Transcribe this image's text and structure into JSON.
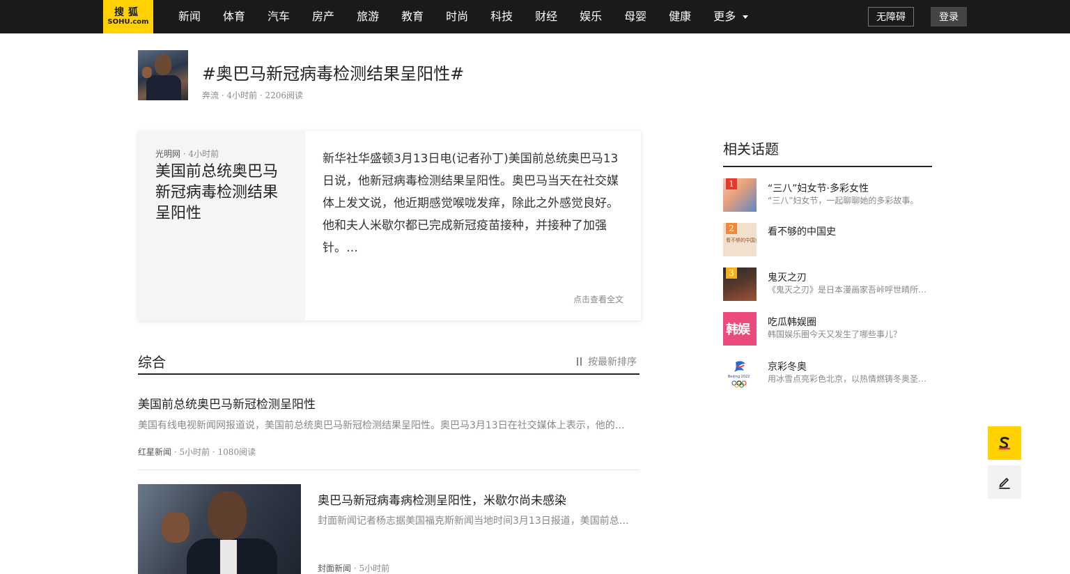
{
  "header": {
    "logo_cn": "搜狐",
    "logo_en": "SOHU.com",
    "nav": [
      "新闻",
      "体育",
      "汽车",
      "房产",
      "旅游",
      "教育",
      "时尚",
      "科技",
      "财经",
      "娱乐",
      "母婴",
      "健康"
    ],
    "more_label": "更多",
    "accessibility_label": "无障碍",
    "login_label": "登录"
  },
  "topic": {
    "title": "#奥巴马新冠病毒检测结果呈阳性#",
    "meta": "奔流 · 4小时前 · 2206阅读"
  },
  "featured": {
    "source": "光明网",
    "time": " · 4小时前",
    "title": "美国前总统奥巴马新冠病毒检测结果呈阳性",
    "summary": "新华社华盛顿3月13日电(记者孙丁)美国前总统奥巴马13日说，他新冠病毒检测结果呈阳性。奥巴马当天在社交媒体上发文说，他近期感觉喉咙发痒，除此之外感觉良好。他和夫人米歇尔都已完成新冠疫苗接种，并接种了加强针。…",
    "read_all": "点击查看全文"
  },
  "section": {
    "title": "综合",
    "sort_label": "按最新排序"
  },
  "articles": [
    {
      "title": "美国前总统奥巴马新冠检测呈阳性",
      "summary": "美国有线电视新闻网报道说，美国前总统奥巴马新冠检测结果呈阳性。奥巴马3月13日在社交媒体上表示，他的新冠检测结果呈阳性，他已经接种疫苗和加强针。",
      "source": "红星新闻",
      "meta": " · 5小时前 · 1080阅读"
    },
    {
      "title": "奥巴马新冠病毒病检测呈阳性，米歇尔尚未感染",
      "summary": "封面新闻记者杨志据美国福克斯新闻当地时间3月13日报道，美国前总统奥巴马新冠病毒检测结果呈阳性。",
      "source": "封面新闻",
      "meta": " · 5小时前"
    }
  ],
  "related": {
    "title": "相关话题",
    "items": [
      {
        "rank": "1",
        "name": "“三八”妇女节·多彩女性",
        "desc": "“三八”妇女节，一起聊聊她的多彩故事。",
        "rank_color": "#e8382e"
      },
      {
        "rank": "2",
        "name": "看不够的中国史",
        "desc": "",
        "thumb_text": "看不够的中国史",
        "rank_color": "#f08a3a"
      },
      {
        "rank": "3",
        "name": "鬼灭之刃",
        "desc": "《鬼灭之刃》是日本漫画家吾峠呼世晴所著的少年漫画。",
        "rank_color": "#f5b021"
      },
      {
        "rank": "",
        "name": "吃瓜韩娱圈",
        "desc": "韩国娱乐圈今天又发生了哪些事儿？",
        "thumb_text": "韩娱"
      },
      {
        "rank": "",
        "name": "京彩冬奥",
        "desc": "用冰雪点亮彩色北京，以热情燃铸冬奥圣火。",
        "thumb_text": "Beijing 2022"
      }
    ]
  },
  "colors": {
    "brand_yellow": "#ffd100",
    "nav_bg": "#1a1a1a"
  }
}
